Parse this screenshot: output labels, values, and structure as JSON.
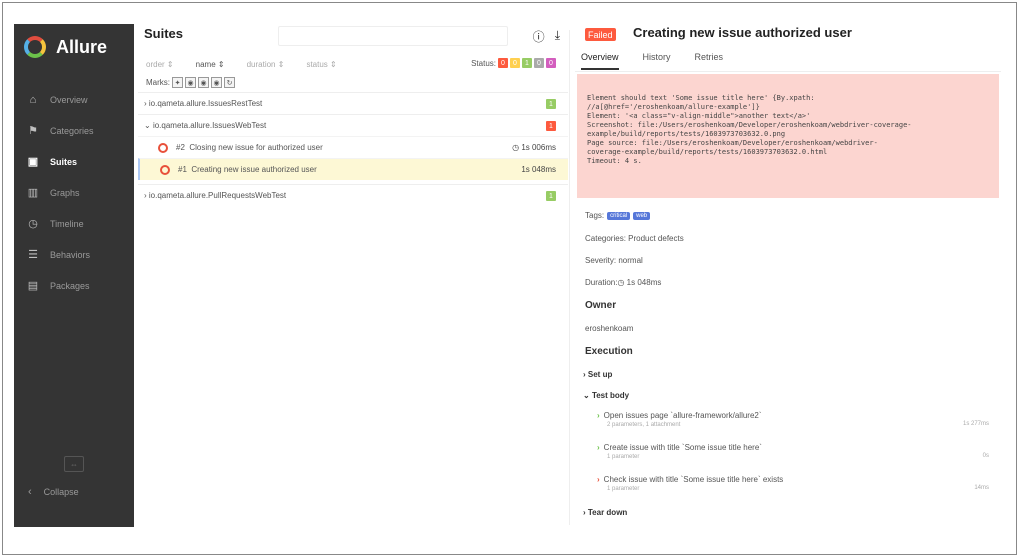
{
  "app": {
    "name": "Allure"
  },
  "sidebar": {
    "items": [
      {
        "label": "Overview",
        "icon": "home-icon"
      },
      {
        "label": "Categories",
        "icon": "flag-icon"
      },
      {
        "label": "Suites",
        "icon": "briefcase-icon"
      },
      {
        "label": "Graphs",
        "icon": "bar-chart-icon"
      },
      {
        "label": "Timeline",
        "icon": "clock-icon"
      },
      {
        "label": "Behaviors",
        "icon": "list-icon"
      },
      {
        "label": "Packages",
        "icon": "package-icon"
      }
    ],
    "active": "Suites",
    "collapse_label": "Collapse"
  },
  "suites": {
    "title": "Suites",
    "sort": [
      "order",
      "name",
      "duration",
      "status"
    ],
    "status_label": "Status:",
    "status_chips": [
      {
        "value": "0",
        "color": "#fd5a3e"
      },
      {
        "value": "0",
        "color": "#ffd050"
      },
      {
        "value": "1",
        "color": "#97cc64"
      },
      {
        "value": "0",
        "color": "#aaaaaa"
      },
      {
        "value": "0",
        "color": "#d35ebe"
      }
    ],
    "marks_label": "Marks:",
    "groups": [
      {
        "name": "io.qameta.allure.IssuesRestTest",
        "count": "1",
        "color": "#97cc64",
        "expanded": false
      },
      {
        "name": "io.qameta.allure.IssuesWebTest",
        "count": "1",
        "color": "#fd5a3e",
        "expanded": true,
        "tests": [
          {
            "index": "#2",
            "name": "Closing new issue for authorized user",
            "duration": "1s 006ms",
            "selected": false
          },
          {
            "index": "#1",
            "name": "Creating new issue authorized user",
            "duration": "1s 048ms",
            "selected": true
          }
        ]
      },
      {
        "name": "io.qameta.allure.PullRequestsWebTest",
        "count": "1",
        "color": "#97cc64",
        "expanded": false
      }
    ]
  },
  "detail": {
    "status_badge": "Failed",
    "title": "Creating new issue authorized user",
    "tabs": [
      "Overview",
      "History",
      "Retries"
    ],
    "error_lines": [
      "Element should text 'Some issue title here' {By.xpath:",
      "//a[@href='/eroshenkoam/allure-example']}",
      "Element: '<a class=\"v-align-middle\">another text</a>'",
      "Screenshot: file:/Users/eroshenkoam/Developer/eroshenkoam/webdriver-coverage-",
      "example/build/reports/tests/1603973703632.0.png",
      "Page source: file:/Users/eroshenkoam/Developer/eroshenkoam/webdriver-",
      "coverage-example/build/reports/tests/1603973703632.0.html",
      "Timeout: 4 s."
    ],
    "tags_label": "Tags:",
    "tags": [
      "critical",
      "web"
    ],
    "categories": "Categories: Product defects",
    "severity": "Severity: normal",
    "duration": "Duration: ",
    "duration_value": "1s 048ms",
    "owner_heading": "Owner",
    "owner": "eroshenkoam",
    "execution_heading": "Execution",
    "setup": "Set up",
    "test_body": "Test body",
    "teardown": "Tear down",
    "steps": [
      {
        "name": "Open issues page `allure-framework/allure2`",
        "sub": "2 parameters, 1 attachment",
        "duration": "1s 277ms",
        "status": "passed"
      },
      {
        "name": "Create issue with title `Some issue title here`",
        "sub": "1 parameter",
        "duration": "0s",
        "status": "passed"
      },
      {
        "name": "Check issue with title `Some issue title here` exists",
        "sub": "1 parameter",
        "duration": "14ms",
        "status": "failed"
      }
    ]
  }
}
